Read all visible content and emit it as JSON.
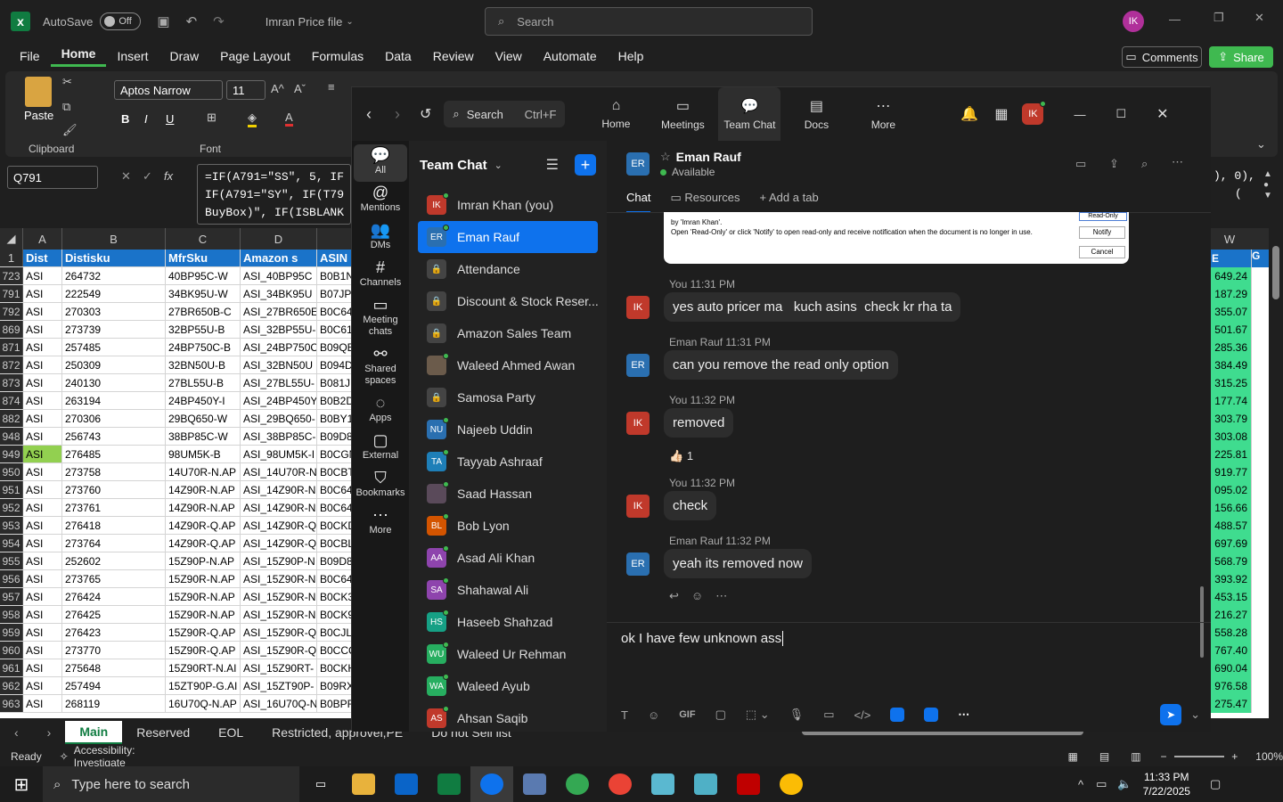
{
  "excel": {
    "autosave_label": "AutoSave",
    "autosave_state": "Off",
    "file_title": "Imran Price file",
    "search_placeholder": "Search",
    "user_initials": "IK",
    "menus": [
      "File",
      "Home",
      "Insert",
      "Draw",
      "Page Layout",
      "Formulas",
      "Data",
      "Review",
      "View",
      "Automate",
      "Help"
    ],
    "comments_label": "Comments",
    "share_label": "Share",
    "ribbon": {
      "paste_label": "Paste",
      "clipboard_label": "Clipboard",
      "font_name": "Aptos Narrow",
      "font_size": "11",
      "font_group_label": "Font",
      "bold": "B",
      "italic": "I",
      "underline": "U"
    },
    "name_box": "Q791",
    "formula_line1": "=IF(A791=\"SS\", 5, IF",
    "formula_line2": "IF(A791=\"SY\", IF(T79",
    "formula_line3": "BuyBox)\", IF(ISBLANK",
    "formula_right1": "), 0),",
    "formula_right2": "(",
    "columns": [
      "A",
      "B",
      "C",
      "D"
    ],
    "header": [
      "Dist",
      "Distisku",
      "MfrSku",
      "Amazon s",
      "ASIN"
    ],
    "right_cols": [
      "W"
    ],
    "right_header": "E",
    "right_header2": "G",
    "rows": [
      {
        "n": "723",
        "a": "ASI",
        "b": "264732",
        "c": "40BP95C-W",
        "d": "ASI_40BP95C",
        "e": "B0B1N",
        "v": "649.24"
      },
      {
        "n": "791",
        "a": "ASI",
        "b": "222549",
        "c": "34BK95U-W",
        "d": "ASI_34BK95U",
        "e": "B07JP",
        "v": "187.29"
      },
      {
        "n": "792",
        "a": "ASI",
        "b": "270303",
        "c": "27BR650B-C",
        "d": "ASI_27BR650E",
        "e": "B0C64",
        "v": "355.07"
      },
      {
        "n": "869",
        "a": "ASI",
        "b": "273739",
        "c": "32BP55U-B",
        "d": "ASI_32BP55U-",
        "e": "B0C61",
        "v": "501.67"
      },
      {
        "n": "871",
        "a": "ASI",
        "b": "257485",
        "c": "24BP750C-B",
        "d": "ASI_24BP750C",
        "e": "B09QE",
        "v": "285.36"
      },
      {
        "n": "872",
        "a": "ASI",
        "b": "250309",
        "c": "32BN50U-B",
        "d": "ASI_32BN50U",
        "e": "B094D",
        "v": "384.49"
      },
      {
        "n": "873",
        "a": "ASI",
        "b": "240130",
        "c": "27BL55U-B",
        "d": "ASI_27BL55U-",
        "e": "B081J",
        "v": "315.25"
      },
      {
        "n": "874",
        "a": "ASI",
        "b": "263194",
        "c": "24BP450Y-I",
        "d": "ASI_24BP450Y",
        "e": "B0B2D",
        "v": "177.74"
      },
      {
        "n": "882",
        "a": "ASI",
        "b": "270306",
        "c": "29BQ650-W",
        "d": "ASI_29BQ650-",
        "e": "B0BY1",
        "v": "303.79"
      },
      {
        "n": "948",
        "a": "ASI",
        "b": "256743",
        "c": "38BP85C-W",
        "d": "ASI_38BP85C-",
        "e": "B09D8",
        "v": "303.08"
      },
      {
        "n": "949",
        "a": "ASI",
        "b": "276485",
        "c": "98UM5K-B",
        "d": "ASI_98UM5K-I",
        "e": "B0CGN",
        "v": "225.81"
      },
      {
        "n": "950",
        "a": "ASI",
        "b": "273758",
        "c": "14U70R-N.AP",
        "d": "ASI_14U70R-N",
        "e": "B0CBT",
        "v": "919.77"
      },
      {
        "n": "951",
        "a": "ASI",
        "b": "273760",
        "c": "14Z90R-N.AP",
        "d": "ASI_14Z90R-N",
        "e": "B0C64",
        "v": "095.02"
      },
      {
        "n": "952",
        "a": "ASI",
        "b": "273761",
        "c": "14Z90R-N.AP",
        "d": "ASI_14Z90R-N",
        "e": "B0C64",
        "v": "156.66"
      },
      {
        "n": "953",
        "a": "ASI",
        "b": "276418",
        "c": "14Z90R-Q.AP",
        "d": "ASI_14Z90R-Q",
        "e": "B0CKD",
        "v": "488.57"
      },
      {
        "n": "954",
        "a": "ASI",
        "b": "273764",
        "c": "14Z90R-Q.AP",
        "d": "ASI_14Z90R-Q",
        "e": "B0CBL",
        "v": "697.69"
      },
      {
        "n": "955",
        "a": "ASI",
        "b": "252602",
        "c": "15Z90P-N.AP",
        "d": "ASI_15Z90P-N",
        "e": "B09D8",
        "v": "568.79"
      },
      {
        "n": "956",
        "a": "ASI",
        "b": "273765",
        "c": "15Z90R-N.AP",
        "d": "ASI_15Z90R-N",
        "e": "B0C64",
        "v": "393.92"
      },
      {
        "n": "957",
        "a": "ASI",
        "b": "276424",
        "c": "15Z90R-N.AP",
        "d": "ASI_15Z90R-N",
        "e": "B0CK3",
        "v": "453.15"
      },
      {
        "n": "958",
        "a": "ASI",
        "b": "276425",
        "c": "15Z90R-N.AP",
        "d": "ASI_15Z90R-N",
        "e": "B0CK9",
        "v": "216.27"
      },
      {
        "n": "959",
        "a": "ASI",
        "b": "276423",
        "c": "15Z90R-Q.AP",
        "d": "ASI_15Z90R-Q",
        "e": "B0CJL",
        "v": "558.28"
      },
      {
        "n": "960",
        "a": "ASI",
        "b": "273770",
        "c": "15Z90R-Q.AP",
        "d": "ASI_15Z90R-Q",
        "e": "B0CCC",
        "v": "767.40"
      },
      {
        "n": "961",
        "a": "ASI",
        "b": "275648",
        "c": "15Z90RT-N.AI",
        "d": "ASI_15Z90RT-",
        "e": "B0CKH",
        "v": "690.04"
      },
      {
        "n": "962",
        "a": "ASI",
        "b": "257494",
        "c": "15ZT90P-G.AI",
        "d": "ASI_15ZT90P-",
        "e": "B09RX",
        "v": "976.58"
      },
      {
        "n": "963",
        "a": "ASI",
        "b": "268119",
        "c": "16U70Q-N.AP",
        "d": "ASI_16U70Q-N",
        "e": "B0BPF",
        "v": "275.47"
      }
    ],
    "sheet_tabs": [
      "Main",
      "Reserved",
      "EOL",
      "Restricted, approvel,PE",
      "Do not Sell list"
    ],
    "status_ready": "Ready",
    "status_accessibility": "Accessibility: Investigate",
    "zoom_level": "100%"
  },
  "zoom": {
    "nav_search": "Search",
    "nav_shortcut": "Ctrl+F",
    "top_nav": [
      "Home",
      "Meetings",
      "Team Chat",
      "Docs",
      "More"
    ],
    "user_initials": "IK",
    "side": [
      "All",
      "Mentions",
      "DMs",
      "Channels",
      "Meeting chats",
      "Shared spaces",
      "Apps",
      "External",
      "Bookmarks",
      "More"
    ],
    "list_title": "Team Chat",
    "contacts": [
      {
        "name": "Imran Khan (you)",
        "ini": "IK",
        "color": "#c0392b",
        "type": "av"
      },
      {
        "name": "Eman Rauf",
        "ini": "ER",
        "color": "#2a6fb0",
        "type": "av"
      },
      {
        "name": "Attendance",
        "ini": "",
        "color": "",
        "type": "lock"
      },
      {
        "name": "Discount & Stock Reser...",
        "ini": "",
        "color": "",
        "type": "lock"
      },
      {
        "name": "Amazon Sales Team",
        "ini": "",
        "color": "",
        "type": "lock"
      },
      {
        "name": "Waleed Ahmed Awan",
        "ini": "",
        "color": "#6b5b4b",
        "type": "av"
      },
      {
        "name": "Samosa Party",
        "ini": "",
        "color": "",
        "type": "lock"
      },
      {
        "name": "Najeeb Uddin",
        "ini": "NU",
        "color": "#2a6fb0",
        "type": "av"
      },
      {
        "name": "Tayyab Ashraaf",
        "ini": "TA",
        "color": "#1e7fb8",
        "type": "av"
      },
      {
        "name": "Saad Hassan",
        "ini": "",
        "color": "#5a4a5a",
        "type": "av"
      },
      {
        "name": "Bob Lyon",
        "ini": "BL",
        "color": "#d35400",
        "type": "av"
      },
      {
        "name": "Asad Ali Khan",
        "ini": "AA",
        "color": "#8e44ad",
        "type": "av"
      },
      {
        "name": "Shahawal Ali",
        "ini": "SA",
        "color": "#8e44ad",
        "type": "av"
      },
      {
        "name": "Haseeb Shahzad",
        "ini": "HS",
        "color": "#16a085",
        "type": "av"
      },
      {
        "name": "Waleed Ur Rehman",
        "ini": "WU",
        "color": "#27ae60",
        "type": "av"
      },
      {
        "name": "Waleed Ayub",
        "ini": "WA",
        "color": "#27ae60",
        "type": "av"
      },
      {
        "name": "Ahsan Saqib",
        "ini": "AS",
        "color": "#c0392b",
        "type": "av"
      }
    ],
    "chat_name": "Eman Rauf",
    "chat_status": "Available",
    "chat_ini": "ER",
    "tabs": [
      "Chat",
      "Resources",
      "Add a tab"
    ],
    "shot_line1": "by 'Imran Khan'.",
    "shot_line2": "Open 'Read-Only' or click 'Notify' to open read-only and receive notification when the document is no longer in use.",
    "shot_btn1": "Read-Only",
    "shot_btn2": "Notify",
    "shot_btn3": "Cancel",
    "messages": [
      {
        "who": "IK",
        "meta": "You 11:31 PM",
        "text": "yes auto pricer ma   kuch asins  check kr rha ta"
      },
      {
        "who": "ER",
        "meta": "Eman Rauf 11:31 PM",
        "text": "can you remove the read only option"
      },
      {
        "who": "IK",
        "meta": "You 11:32 PM",
        "text": "removed"
      },
      {
        "who": "IK",
        "meta": "You 11:32 PM",
        "text": "check"
      },
      {
        "who": "ER",
        "meta": "Eman Rauf 11:32 PM",
        "text": "yeah its removed now"
      }
    ],
    "reaction_count": "1",
    "compose_text": "ok I have few unknown ass"
  },
  "taskbar": {
    "search_placeholder": "Type here to search",
    "time": "11:33 PM",
    "date": "7/22/2025"
  }
}
